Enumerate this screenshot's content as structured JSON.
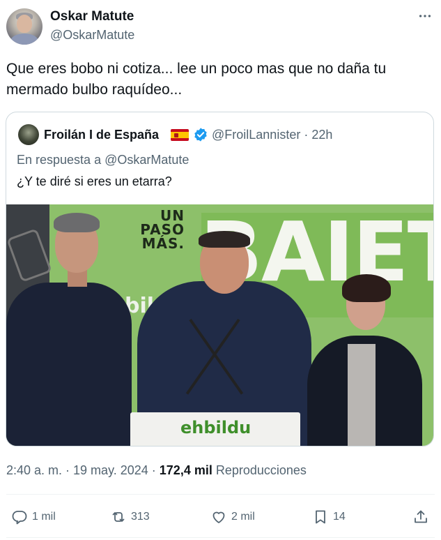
{
  "author": {
    "name": "Oskar Matute",
    "handle": "@OskarMatute"
  },
  "tweet": {
    "text": "Que eres bobo ni cotiza... lee un poco mas que no daña tu mermado bulbo raquídeo..."
  },
  "quoted": {
    "name": "Froilán I de España",
    "handle_time": "@FroilLannister · 22h",
    "reply_prefix": "En respuesta a ",
    "reply_to": "@OskarMatute",
    "text": "¿Y te diré si eres un etarra?",
    "image": {
      "slogan_small": "UN PASO MÁS.",
      "slogan_big": "BAIETZ!",
      "brand_bg": "bildu",
      "podium_logo": "ehbildu"
    }
  },
  "meta": {
    "time_date": "2:40 a. m. · 19 may. 2024 · ",
    "views_count": "172,4 mil",
    "views_label": " Reproducciones"
  },
  "actions": {
    "replies": "1 mil",
    "reposts": "313",
    "likes": "2 mil",
    "bookmarks": "14"
  },
  "colors": {
    "text_primary": "#0f1419",
    "text_secondary": "#536471",
    "verified": "#1d9bf0",
    "border": "#cfd9de"
  },
  "icons": [
    "more-icon",
    "verified-badge-icon",
    "spain-flag-icon",
    "reply-icon",
    "repost-icon",
    "like-icon",
    "bookmark-icon",
    "share-icon"
  ]
}
